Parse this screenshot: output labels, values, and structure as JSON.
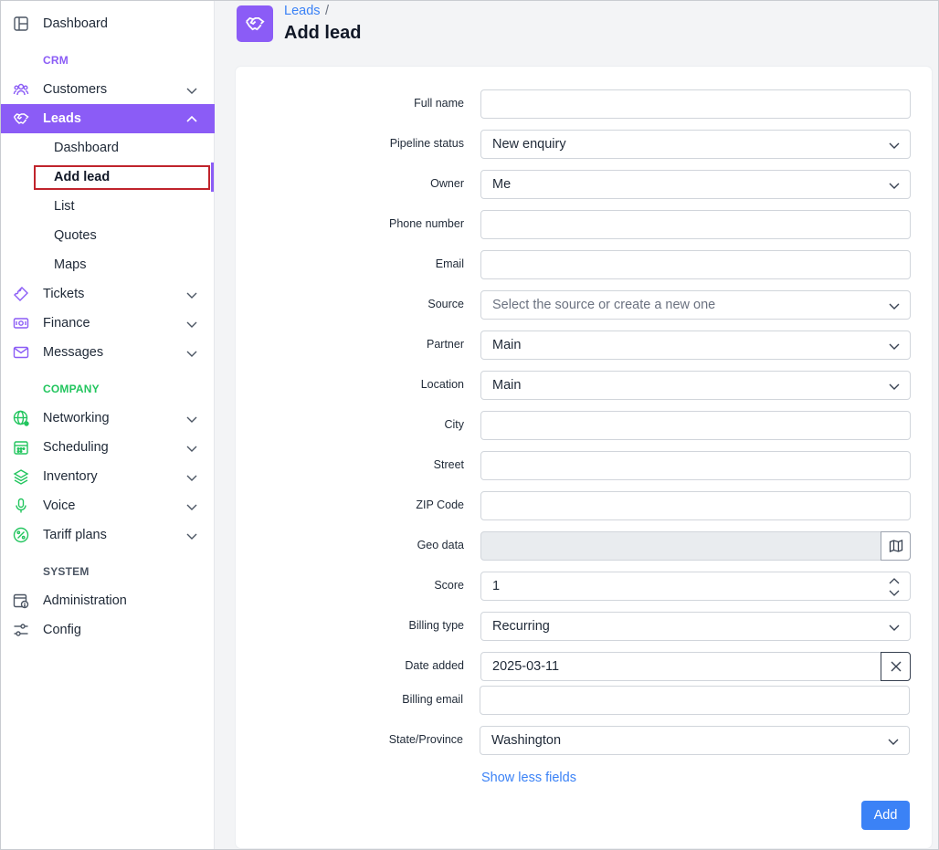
{
  "sidebar": {
    "top": {
      "label": "Dashboard",
      "icon": "dashboard-icon"
    },
    "sections": {
      "crm": "CRM",
      "company": "COMPANY",
      "system": "SYSTEM"
    },
    "section_colors": {
      "crm": "#8b5cf6",
      "company": "#22c55e",
      "system": "#4b5563"
    },
    "crm_items": {
      "customers": "Customers",
      "leads": "Leads",
      "tickets": "Tickets",
      "finance": "Finance",
      "messages": "Messages"
    },
    "leads_sub": {
      "dashboard": "Dashboard",
      "add_lead": "Add lead",
      "list": "List",
      "quotes": "Quotes",
      "maps": "Maps"
    },
    "company_items": {
      "networking": "Networking",
      "scheduling": "Scheduling",
      "inventory": "Inventory",
      "voice": "Voice",
      "tariff_plans": "Tariff plans"
    },
    "system_items": {
      "administration": "Administration",
      "config": "Config"
    }
  },
  "header": {
    "breadcrumb": "Leads",
    "separator": "/",
    "title": "Add lead",
    "accent": "#8b5cf6"
  },
  "form": {
    "full_name": {
      "label": "Full name",
      "value": ""
    },
    "pipeline_status": {
      "label": "Pipeline status",
      "value": "New enquiry"
    },
    "owner": {
      "label": "Owner",
      "value": "Me"
    },
    "phone_number": {
      "label": "Phone number",
      "value": ""
    },
    "email": {
      "label": "Email",
      "value": ""
    },
    "source": {
      "label": "Source",
      "placeholder": "Select the source or create a new one"
    },
    "partner": {
      "label": "Partner",
      "value": "Main"
    },
    "location": {
      "label": "Location",
      "value": "Main"
    },
    "city": {
      "label": "City",
      "value": ""
    },
    "street": {
      "label": "Street",
      "value": ""
    },
    "zip_code": {
      "label": "ZIP Code",
      "value": ""
    },
    "geo_data": {
      "label": "Geo data",
      "value": ""
    },
    "score": {
      "label": "Score",
      "value": "1"
    },
    "billing_type": {
      "label": "Billing type",
      "value": "Recurring"
    },
    "date_added": {
      "label": "Date added",
      "value": "2025-03-11"
    },
    "billing_email": {
      "label": "Billing email",
      "value": ""
    },
    "state_province": {
      "label": "State/Province",
      "value": "Washington"
    },
    "show_less": "Show less fields",
    "submit": "Add",
    "link_color": "#3b82f6"
  }
}
